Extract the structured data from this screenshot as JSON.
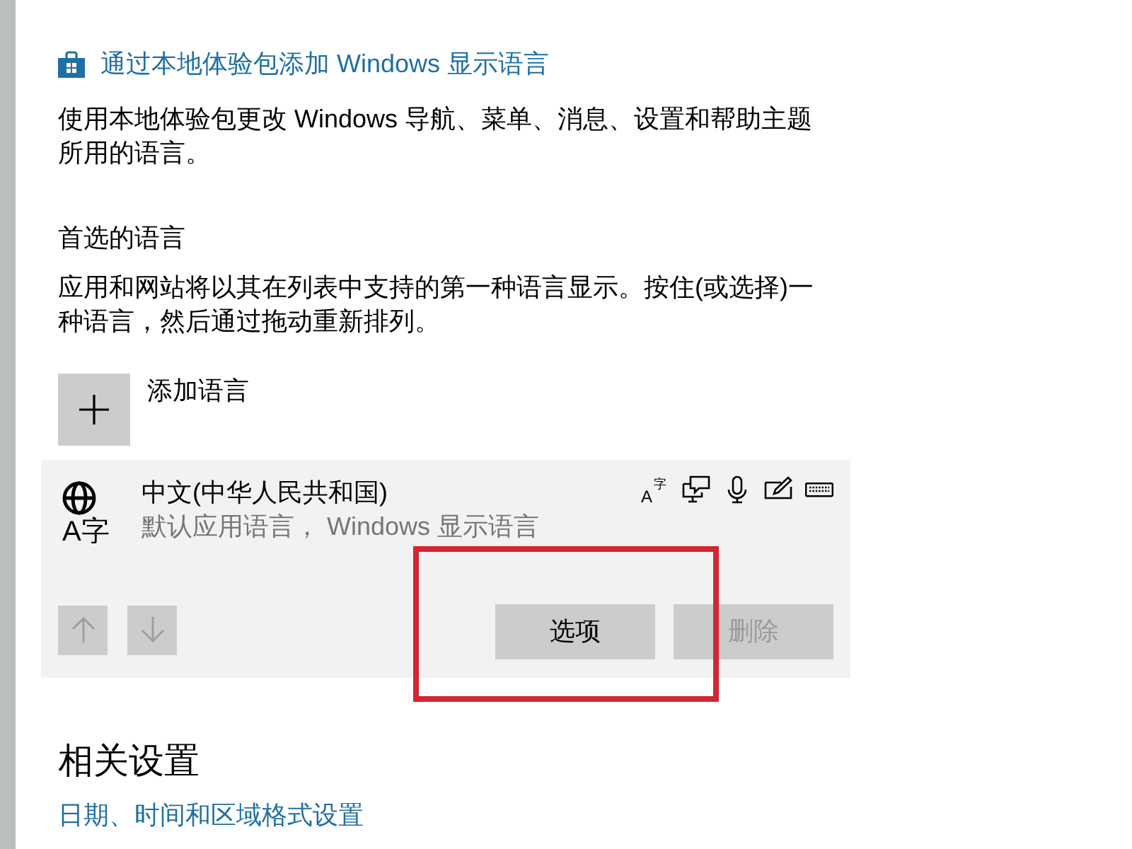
{
  "experience_pack_link": {
    "text": "通过本地体验包添加 Windows 显示语言"
  },
  "experience_pack_description": "使用本地体验包更改 Windows 导航、菜单、消息、设置和帮助主题所用的语言。",
  "preferred_languages": {
    "heading": "首选的语言",
    "description": "应用和网站将以其在列表中支持的第一种语言显示。按住(或选择)一种语言，然后通过拖动重新排列。",
    "add_button": {
      "label": "添加语言"
    },
    "languages": [
      {
        "name": "中文(中华人民共和国)",
        "subtitle": "默认应用语言， Windows 显示语言",
        "glyph": "A字",
        "selected": true,
        "features": [
          {
            "kind": "text",
            "glyph": "A字"
          },
          {
            "kind": "display"
          },
          {
            "kind": "speech"
          },
          {
            "kind": "handwriting"
          },
          {
            "kind": "keyboard"
          }
        ],
        "move_buttons": [
          {
            "kind": "up",
            "disabled": true
          },
          {
            "kind": "down",
            "disabled": true
          }
        ],
        "actions": [
          {
            "label": "选项",
            "disabled": false
          },
          {
            "label": "删除",
            "disabled": true
          }
        ]
      }
    ]
  },
  "related_settings": {
    "heading": "相关设置",
    "links": [
      "日期、时间和区域格式设置"
    ]
  }
}
